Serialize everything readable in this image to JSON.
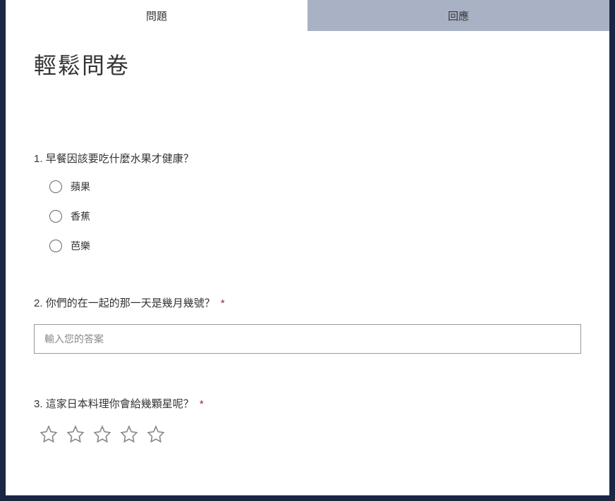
{
  "tabs": {
    "questions": "問題",
    "responses": "回應"
  },
  "form": {
    "title": "輕鬆問卷"
  },
  "questions": [
    {
      "number": "1.",
      "text": "早餐因該要吃什麼水果才健康？",
      "required": false,
      "type": "radio",
      "options": [
        "蘋果",
        "香蕉",
        "芭樂"
      ]
    },
    {
      "number": "2.",
      "text": "你們的在一起的那一天是幾月幾號？",
      "required": true,
      "type": "text",
      "placeholder": "輸入您的答案"
    },
    {
      "number": "3.",
      "text": "這家日本料理你會給幾顆星呢？",
      "required": true,
      "type": "rating",
      "stars": 5
    }
  ],
  "required_mark": "*"
}
